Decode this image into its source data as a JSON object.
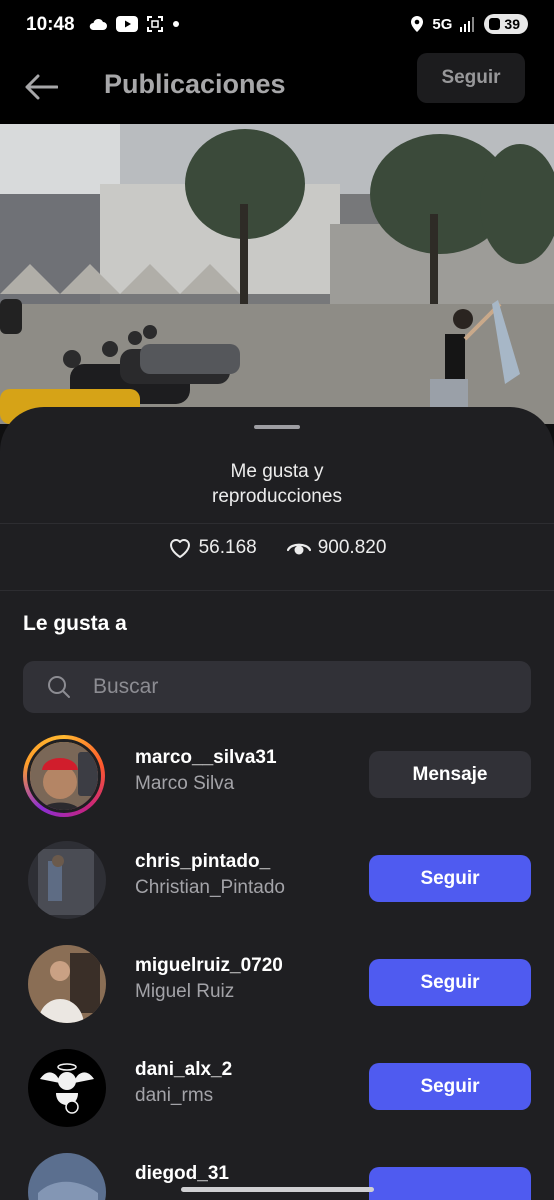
{
  "status_bar": {
    "time": "10:48",
    "network": "5G",
    "battery": "39",
    "icons": [
      "cloud-icon",
      "youtube-icon",
      "screen-capture-icon",
      "dot-icon",
      "location-icon",
      "signal-icon"
    ]
  },
  "app_bar": {
    "title": "Publicaciones",
    "follow_label": "Seguir",
    "back_icon": "arrow-left-icon"
  },
  "sheet": {
    "title_line1": "Me gusta y",
    "title_line2": "reproducciones",
    "likes": "56.168",
    "views": "900.820",
    "section_title": "Le gusta a",
    "search_placeholder": "Buscar"
  },
  "users": [
    {
      "username": "marco__silva31",
      "fullname": "Marco Silva",
      "action": "Mensaje",
      "story_ring": true
    },
    {
      "username": "chris_pintado_",
      "fullname": "Christian_Pintado",
      "action": "Seguir",
      "story_ring": false
    },
    {
      "username": "miguelruiz_0720",
      "fullname": "Miguel Ruiz",
      "action": "Seguir",
      "story_ring": false
    },
    {
      "username": "dani_alx_2",
      "fullname": "dani_rms",
      "action": "Seguir",
      "story_ring": false
    },
    {
      "username": "diegod_31",
      "fullname": "",
      "action": "",
      "story_ring": false
    }
  ],
  "colors": {
    "follow_button": "#4f5bf0",
    "message_button": "#313137",
    "sheet_background": "#1f1f22"
  }
}
